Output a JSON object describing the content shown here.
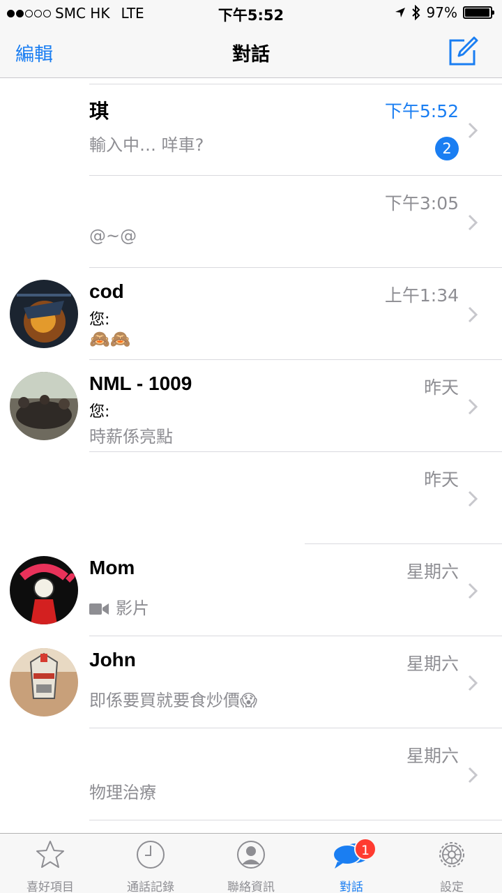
{
  "status_bar": {
    "carrier": "SMC HK",
    "network": "LTE",
    "time": "下午5:52",
    "battery": "97%",
    "battery_level": 0.97
  },
  "nav": {
    "edit_label": "編輯",
    "title": "對話",
    "compose_icon": "compose-icon"
  },
  "conversations": [
    {
      "name": "琪",
      "time": "下午5:52",
      "preview": "輸入中… 咩車?",
      "unread": "2"
    },
    {
      "name": "",
      "time": "下午3:05",
      "preview": "@~@"
    },
    {
      "name": "cod",
      "time": "上午1:34",
      "sender": "您:",
      "preview": "🙈🙈"
    },
    {
      "name": "NML - 1009",
      "time": "昨天",
      "sender": "您:",
      "preview": "時薪係亮點"
    },
    {
      "name": "",
      "time": "昨天",
      "preview": ""
    },
    {
      "name": "Mom",
      "time": "星期六",
      "preview": "影片"
    },
    {
      "name": "John",
      "time": "星期六",
      "preview": "即係要買就要食炒價😱"
    },
    {
      "name": "",
      "time": "星期六",
      "preview": "物理治療"
    }
  ],
  "tabs": [
    {
      "label": "喜好項目",
      "icon": "star-icon"
    },
    {
      "label": "通話記錄",
      "icon": "clock-icon"
    },
    {
      "label": "聯絡資訊",
      "icon": "contact-icon"
    },
    {
      "label": "對話",
      "icon": "chat-bubbles-icon",
      "badge": "1"
    },
    {
      "label": "設定",
      "icon": "gear-icon"
    }
  ]
}
